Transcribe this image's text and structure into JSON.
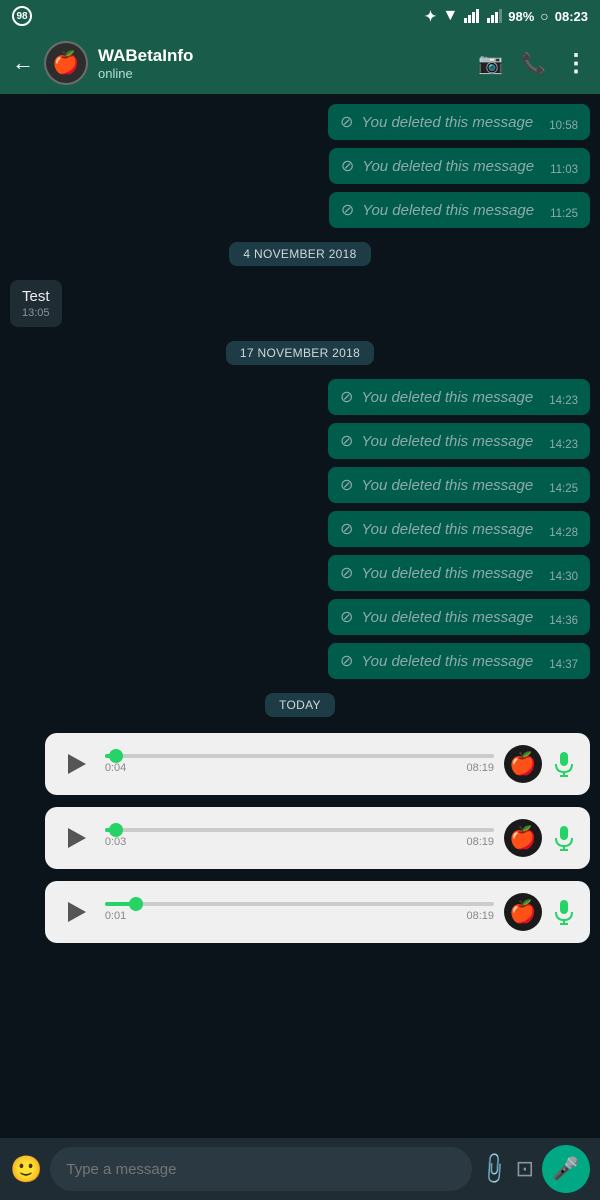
{
  "statusBar": {
    "leftNum": "98",
    "battery": "98%",
    "time": "08:23"
  },
  "header": {
    "name": "WABetaInfo",
    "status": "online",
    "avatarIcon": "🍎",
    "backArrow": "←"
  },
  "messages": [
    {
      "id": "m1",
      "type": "deleted",
      "text": "You deleted this message",
      "time": "10:58"
    },
    {
      "id": "m2",
      "type": "deleted",
      "text": "You deleted this message",
      "time": "11:03"
    },
    {
      "id": "m3",
      "type": "deleted",
      "text": "You deleted this message",
      "time": "11:25"
    },
    {
      "id": "m4",
      "type": "date",
      "text": "4 NOVEMBER 2018"
    },
    {
      "id": "m5",
      "type": "received",
      "text": "Test",
      "time": "13:05"
    },
    {
      "id": "m6",
      "type": "date",
      "text": "17 NOVEMBER 2018"
    },
    {
      "id": "m7",
      "type": "deleted",
      "text": "You deleted this message",
      "time": "14:23"
    },
    {
      "id": "m8",
      "type": "deleted",
      "text": "You deleted this message",
      "time": "14:23"
    },
    {
      "id": "m9",
      "type": "deleted",
      "text": "You deleted this message",
      "time": "14:25"
    },
    {
      "id": "m10",
      "type": "deleted",
      "text": "You deleted this message",
      "time": "14:28"
    },
    {
      "id": "m11",
      "type": "deleted",
      "text": "You deleted this message",
      "time": "14:30"
    },
    {
      "id": "m12",
      "type": "deleted",
      "text": "You deleted this message",
      "time": "14:36"
    },
    {
      "id": "m13",
      "type": "deleted",
      "text": "You deleted this message",
      "time": "14:37"
    },
    {
      "id": "m14",
      "type": "date",
      "text": "TODAY"
    },
    {
      "id": "m15",
      "type": "voice",
      "duration": "0:04",
      "sentTime": "08:19",
      "progress": 3
    },
    {
      "id": "m16",
      "type": "voice",
      "duration": "0:03",
      "sentTime": "08:19",
      "progress": 3
    },
    {
      "id": "m17",
      "type": "voice",
      "duration": "0:01",
      "sentTime": "08:19",
      "progress": 8
    }
  ],
  "inputBar": {
    "placeholder": "Type a message"
  },
  "icons": {
    "deleted": "⊘",
    "back": "←",
    "videoCall": "📹",
    "phone": "📞",
    "more": "⋮",
    "emoji": "🙂",
    "attach": "📎",
    "camera": "▣",
    "mic": "🎤"
  }
}
